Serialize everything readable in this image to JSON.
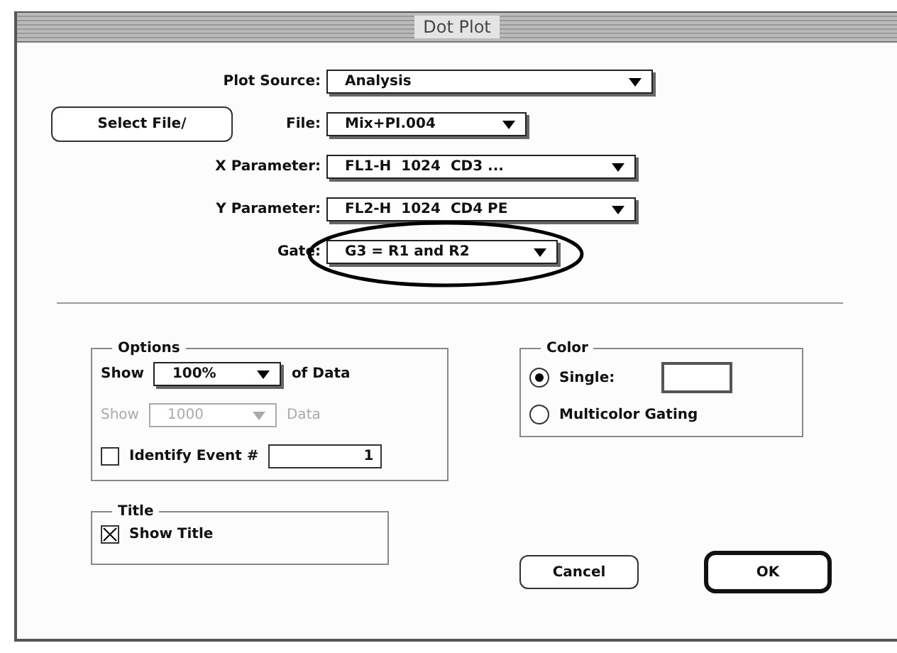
{
  "window": {
    "title": "Dot Plot"
  },
  "fields": [
    {
      "label": "Plot Source:",
      "value": "Analysis"
    },
    {
      "label": "File:",
      "value": "Mix+PI.004"
    },
    {
      "label": "X Parameter:",
      "value": "FL1-H  1024  CD3 ..."
    },
    {
      "label": "Y Parameter:",
      "value": "FL2-H  1024  CD4 PE"
    },
    {
      "label": "Gate:",
      "value": "G3 = R1 and R2",
      "circled": true
    }
  ],
  "select_file_button": "Select File/",
  "options": {
    "title": "Options",
    "rows": [
      {
        "prefix": "Show",
        "value": "100%",
        "suffix": "of Data",
        "disabled": false
      },
      {
        "prefix": "Show",
        "value": "1000",
        "suffix": "Data",
        "disabled": true
      }
    ],
    "identify": {
      "label": "Identify Event #",
      "checked": false,
      "value": "1"
    }
  },
  "color": {
    "title": "Color",
    "choices": [
      {
        "label": "Single:",
        "selected": true,
        "swatch": true
      },
      {
        "label": "Multicolor Gating",
        "selected": false
      }
    ]
  },
  "title_box": {
    "title": "Title",
    "label": "Show Title",
    "checked": true
  },
  "buttons": [
    {
      "label": "Cancel",
      "default": false
    },
    {
      "label": "OK",
      "default": true
    }
  ]
}
